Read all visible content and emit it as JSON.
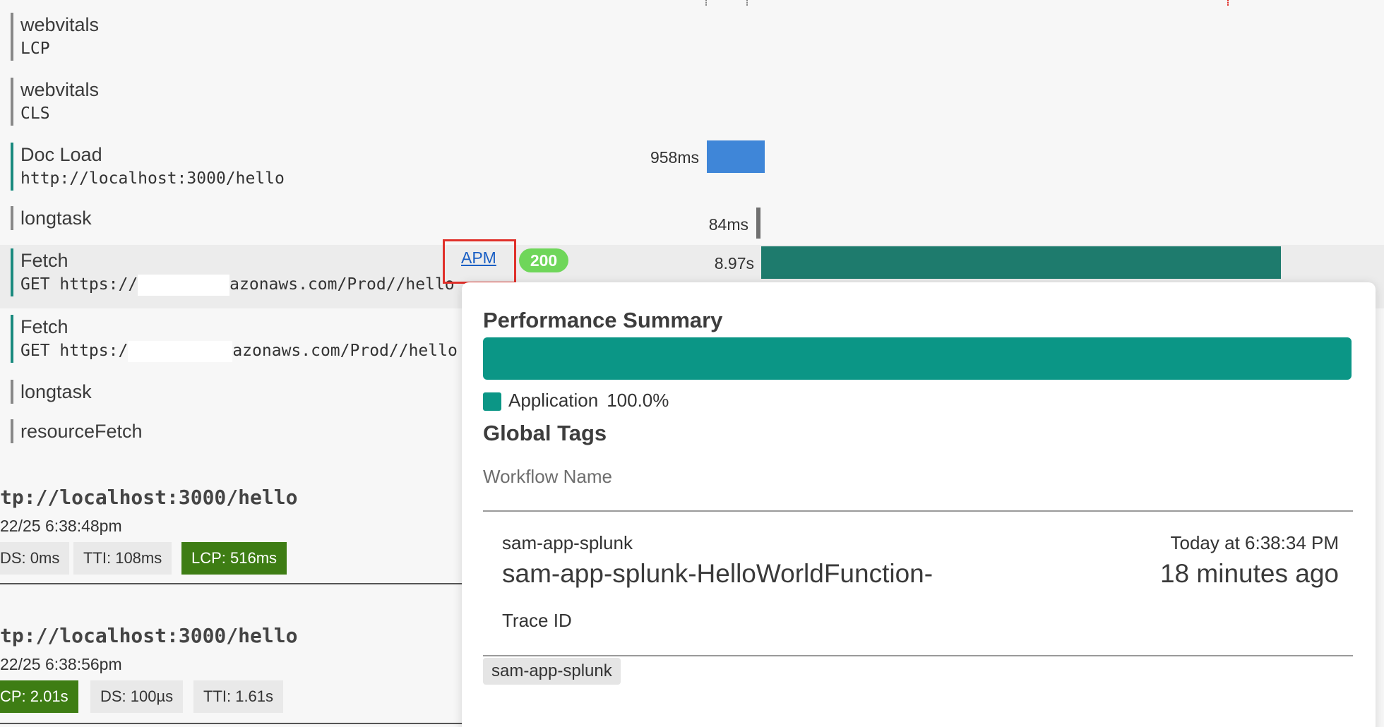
{
  "spans": [
    {
      "name": "webvitals",
      "sub": "LCP"
    },
    {
      "name": "webvitals",
      "sub": "CLS"
    },
    {
      "name": "Doc Load",
      "sub": "http://localhost:3000/hello",
      "duration": "958ms",
      "bar_color": "#3f86d8"
    },
    {
      "name": "longtask",
      "duration": "84ms",
      "bar_color": "#707070"
    },
    {
      "name": "Fetch",
      "sub_prefix": "GET https://",
      "sub_suffix": "azonaws.com/Prod//hello",
      "link": "APM",
      "status": "200",
      "duration": "8.97s",
      "bar_color": "#1e7b6d"
    },
    {
      "name": "Fetch",
      "sub_prefix": "GET https:/",
      "sub_suffix": "azonaws.com/Prod//hello"
    },
    {
      "name": "longtask"
    },
    {
      "name": "resourceFetch"
    }
  ],
  "sessions": [
    {
      "url": "tp://localhost:3000/hello",
      "date": "22/25 6:38:48pm",
      "chips": [
        "DS: 0ms",
        "TTI: 108ms",
        "LCP: 516ms"
      ]
    },
    {
      "url": "tp://localhost:3000/hello",
      "date": "22/25 6:38:56pm",
      "chips": [
        "CP: 2.01s",
        "DS: 100µs",
        "TTI: 1.61s"
      ]
    }
  ],
  "popover": {
    "perf_title": "Performance Summary",
    "legend_label": "Application",
    "legend_pct": "100.0%",
    "application_share": 1.0,
    "tags_title": "Global Tags",
    "tag_label": "Workflow Name",
    "trace": {
      "service": "sam-app-splunk",
      "operation": "sam-app-splunk-HelloWorldFunction-",
      "time": "Today at 6:38:34 PM",
      "ago": "18 minutes ago",
      "trace_id_label": "Trace ID",
      "tag_chip": "sam-app-splunk"
    }
  },
  "colors": {
    "accent_teal": "#0b9686",
    "status_green": "#6fd65a",
    "lcp_green": "#3e7d14",
    "highlight_red": "#e0302a"
  }
}
